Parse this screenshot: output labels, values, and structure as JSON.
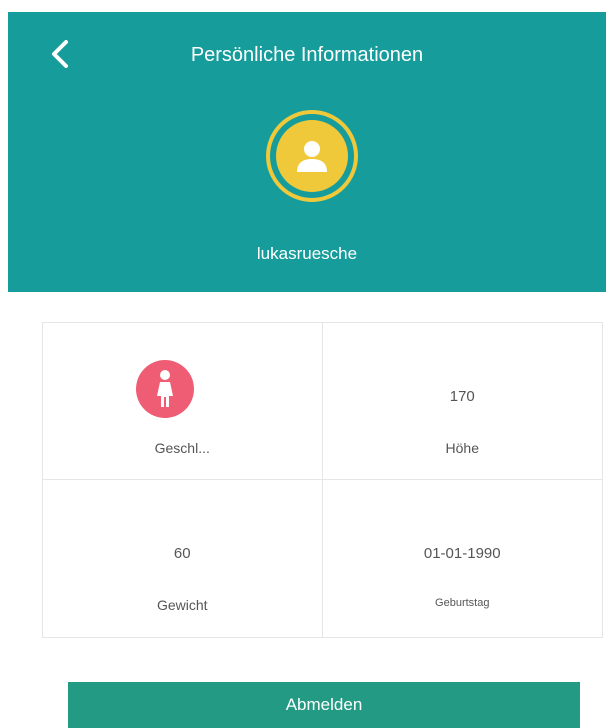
{
  "header": {
    "title": "Persönliche Informationen",
    "back_icon": "chevron-left-icon",
    "username": "lukasruesche",
    "avatar_icon": "user-icon",
    "background_color": "#179c9c",
    "avatar_color": "#f0c93a"
  },
  "info": {
    "gender": {
      "label": "Geschl...",
      "icon": "female-icon",
      "icon_color": "#ef5d74"
    },
    "height": {
      "value": "170",
      "label": "Höhe"
    },
    "weight": {
      "value": "60",
      "label": "Gewicht"
    },
    "birthday": {
      "value": "01-01-1990",
      "label": "Geburtstag"
    }
  },
  "actions": {
    "logout_label": "Abmelden",
    "logout_color": "#239a83"
  }
}
